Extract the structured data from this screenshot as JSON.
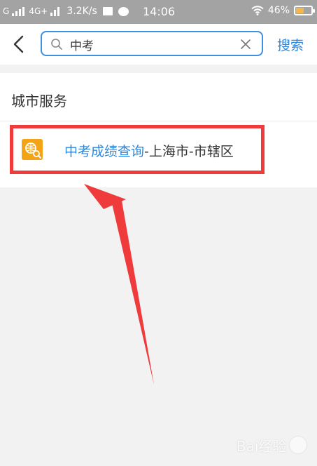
{
  "status_bar": {
    "carrier_1": "G",
    "carrier_2": "4G+",
    "net_speed": "3.2K/s",
    "time": "14:06",
    "battery": "46%"
  },
  "header": {
    "search_value": "中考",
    "search_button": "搜索"
  },
  "section": {
    "title": "城市服务",
    "results": [
      {
        "highlight": "中考成绩查询",
        "rest": "-上海市-市辖区"
      }
    ]
  },
  "watermark": {
    "text": "Bai经验"
  },
  "colors": {
    "accent": "#2d88e0",
    "annotation_red": "#ef3b3b",
    "icon_orange": "#f3a316"
  }
}
